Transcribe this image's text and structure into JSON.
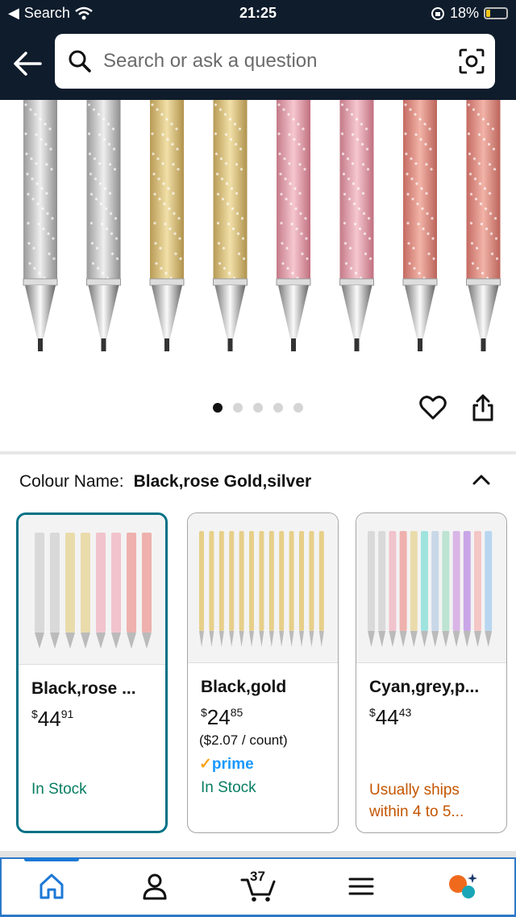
{
  "status": {
    "back_label": "Search",
    "time": "21:25",
    "battery": "18%"
  },
  "search": {
    "placeholder": "Search or ask a question"
  },
  "gallery": {
    "pens": [
      "silver",
      "silver",
      "gold",
      "gold",
      "pink",
      "pink",
      "rose",
      "rose"
    ],
    "dots": 5,
    "active_dot": 0
  },
  "variation": {
    "label": "Colour Name:",
    "value": "Black,rose Gold,silver"
  },
  "cards": [
    {
      "name": "Black,rose ...",
      "price_whole": "44",
      "price_frac": "91",
      "currency": "$",
      "unit": "",
      "prime": false,
      "availability": "In Stock"
    },
    {
      "name": "Black,gold",
      "price_whole": "24",
      "price_frac": "85",
      "currency": "$",
      "unit": "($2.07 / count)",
      "prime": true,
      "availability": "In Stock"
    },
    {
      "name": "Cyan,grey,p...",
      "price_whole": "44",
      "price_frac": "43",
      "currency": "$",
      "unit": "",
      "prime": false,
      "availability": "Usually ships within 4 to 5..."
    }
  ],
  "prime_label": "prime",
  "tabbar": {
    "cart_count": "37"
  },
  "colors": {
    "nav_bg": "#0f1c2c",
    "accent": "#007185",
    "stock": "#067d62",
    "ships": "#c45500",
    "tab_active": "#1d78d6"
  }
}
